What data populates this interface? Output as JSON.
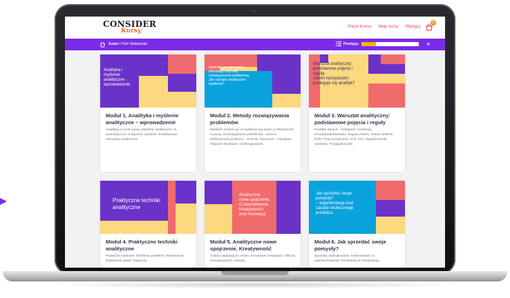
{
  "brand": {
    "name": "CONSIDER",
    "sub": "Kursy"
  },
  "nav": [
    "Panel Konsu",
    "Moje kursy",
    "Wyloguj"
  ],
  "cart": {
    "icon": "cart-icon",
    "count": "0"
  },
  "author": {
    "label": "Autor:",
    "name": "Piotr Wałędziak"
  },
  "progress": {
    "label": "Postępy:",
    "fraction": 0.25
  },
  "colors": {
    "purple": "#7b2be8",
    "yellow": "#fcd87e",
    "pink": "#f06b6b",
    "blue": "#0aa2dd",
    "violet": "#6a32c9"
  },
  "modules": [
    {
      "thumb": "Analityka i\nmyślenie\nanalityczne -\nwprowadzenie",
      "title": "Moduł 1. Analityka i myślenie analityczne – wprowadzenie",
      "desc": "Analityka a rynek pracy. Myślenie analityczne vs automatyczne. Krytyczne myślenie. Podstawowe narzędzia analityczne."
    },
    {
      "thumb": "Sposoby przetwarzania\ninformacji i techniki\nrozwiązywania problemów.\nJak rozwijać analityczne\nmyślenie?",
      "title": "Moduł 2. Metody rozwiązywania problemów",
      "desc": "Myślenie bottom-up vs myślenie top-down a efektywność w pracy. Rozwiązywanie problemów - proces. Definiowanie problemu - techniki. Research - metodyka. Aktywne słuchanie. Challengowanie."
    },
    {
      "thumb": "Warsztat analityczny:\npodstawowe pojęcia i\nreguły.\nJakimi narzędziami\nposługuje się analityk?",
      "title": "Moduł 3. Warsztat analityczny: podstawowe pojęcia i reguły",
      "desc": "Rozkład danych - histogram. Korelacja. Prawdopodobieństwo. Reguła Pareto. Prawo wielkich liczb. Próg rentowności. ROI. KPI. Ograniczoność zasobów. Przypadkowość."
    },
    {
      "thumb": "Praktyczne techniki\nanalityczne",
      "title": "Moduł 4. Praktyczne techniki analityczne",
      "desc": "Podejście naukowe. Dzielenie problemu. Planowanie. Zadawanie pytań. Diagramy"
    },
    {
      "thumb": "Analityczne\nnowe spojrzenie.\nO poszukiwaniu\nkreatywności\noraz innowacji",
      "title": "Moduł 5. Analityczne nowe spojrzenie. Kreatywność",
      "desc": "Sztuka adaptacji do zmian. Kreatywne rozwiązań. Obłicza innowacyjności. Metody"
    },
    {
      "thumb": "Jak sprzedać swoje\npomysły?\n– argumentacja oraz\nzasady skutecznego\nprzekazu.",
      "title": "Moduł 6. Jak sprzedać swoje pomysły?",
      "desc": "Sposoby oddziaływania. Analizowanie vs argumentowanie. Perswazja vs manipulacja."
    }
  ]
}
